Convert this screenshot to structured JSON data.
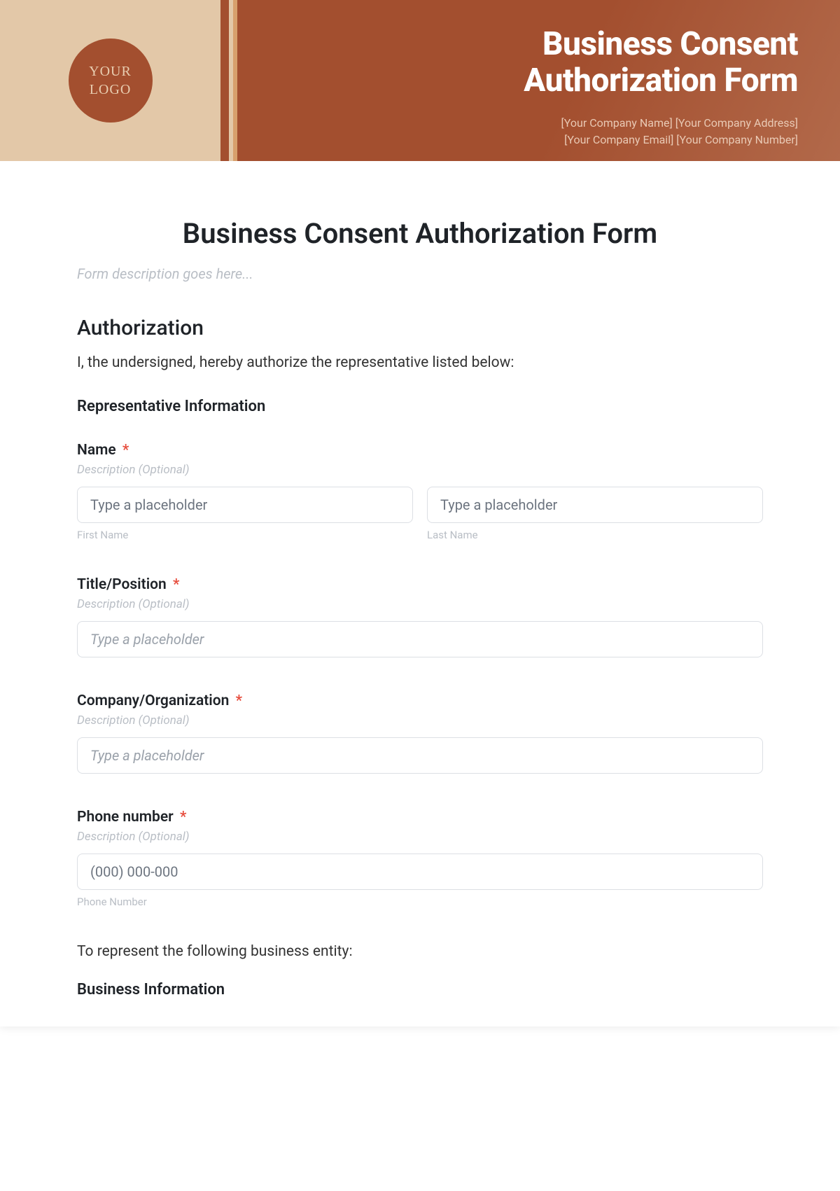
{
  "hero": {
    "logo_line1": "YOUR",
    "logo_line2": "LOGO",
    "title_line1": "Business Consent",
    "title_line2": "Authorization Form",
    "meta_line1": "[Your Company Name] [Your Company Address]",
    "meta_line2": "[Your Company Email] [Your Company Number]"
  },
  "form": {
    "title": "Business Consent Authorization Form",
    "description": "Form description goes here...",
    "authorization_heading": "Authorization",
    "authorization_text": "I, the undersigned, hereby authorize the representative listed below:",
    "rep_heading": "Representative Information",
    "fields": {
      "name": {
        "label": "Name",
        "required": "*",
        "desc": "Description (Optional)",
        "first_placeholder": "Type a placeholder",
        "last_placeholder": "Type a placeholder",
        "first_sub": "First Name",
        "last_sub": "Last Name"
      },
      "title": {
        "label": "Title/Position",
        "required": "*",
        "desc": "Description (Optional)",
        "placeholder": "Type a placeholder"
      },
      "company": {
        "label": "Company/Organization",
        "required": "*",
        "desc": "Description (Optional)",
        "placeholder": "Type a placeholder"
      },
      "phone": {
        "label": "Phone number",
        "required": "*",
        "desc": "Description (Optional)",
        "placeholder": "(000) 000-000",
        "sub": "Phone Number"
      }
    },
    "entity_text": "To represent the following business entity:",
    "business_heading": "Business Information"
  }
}
